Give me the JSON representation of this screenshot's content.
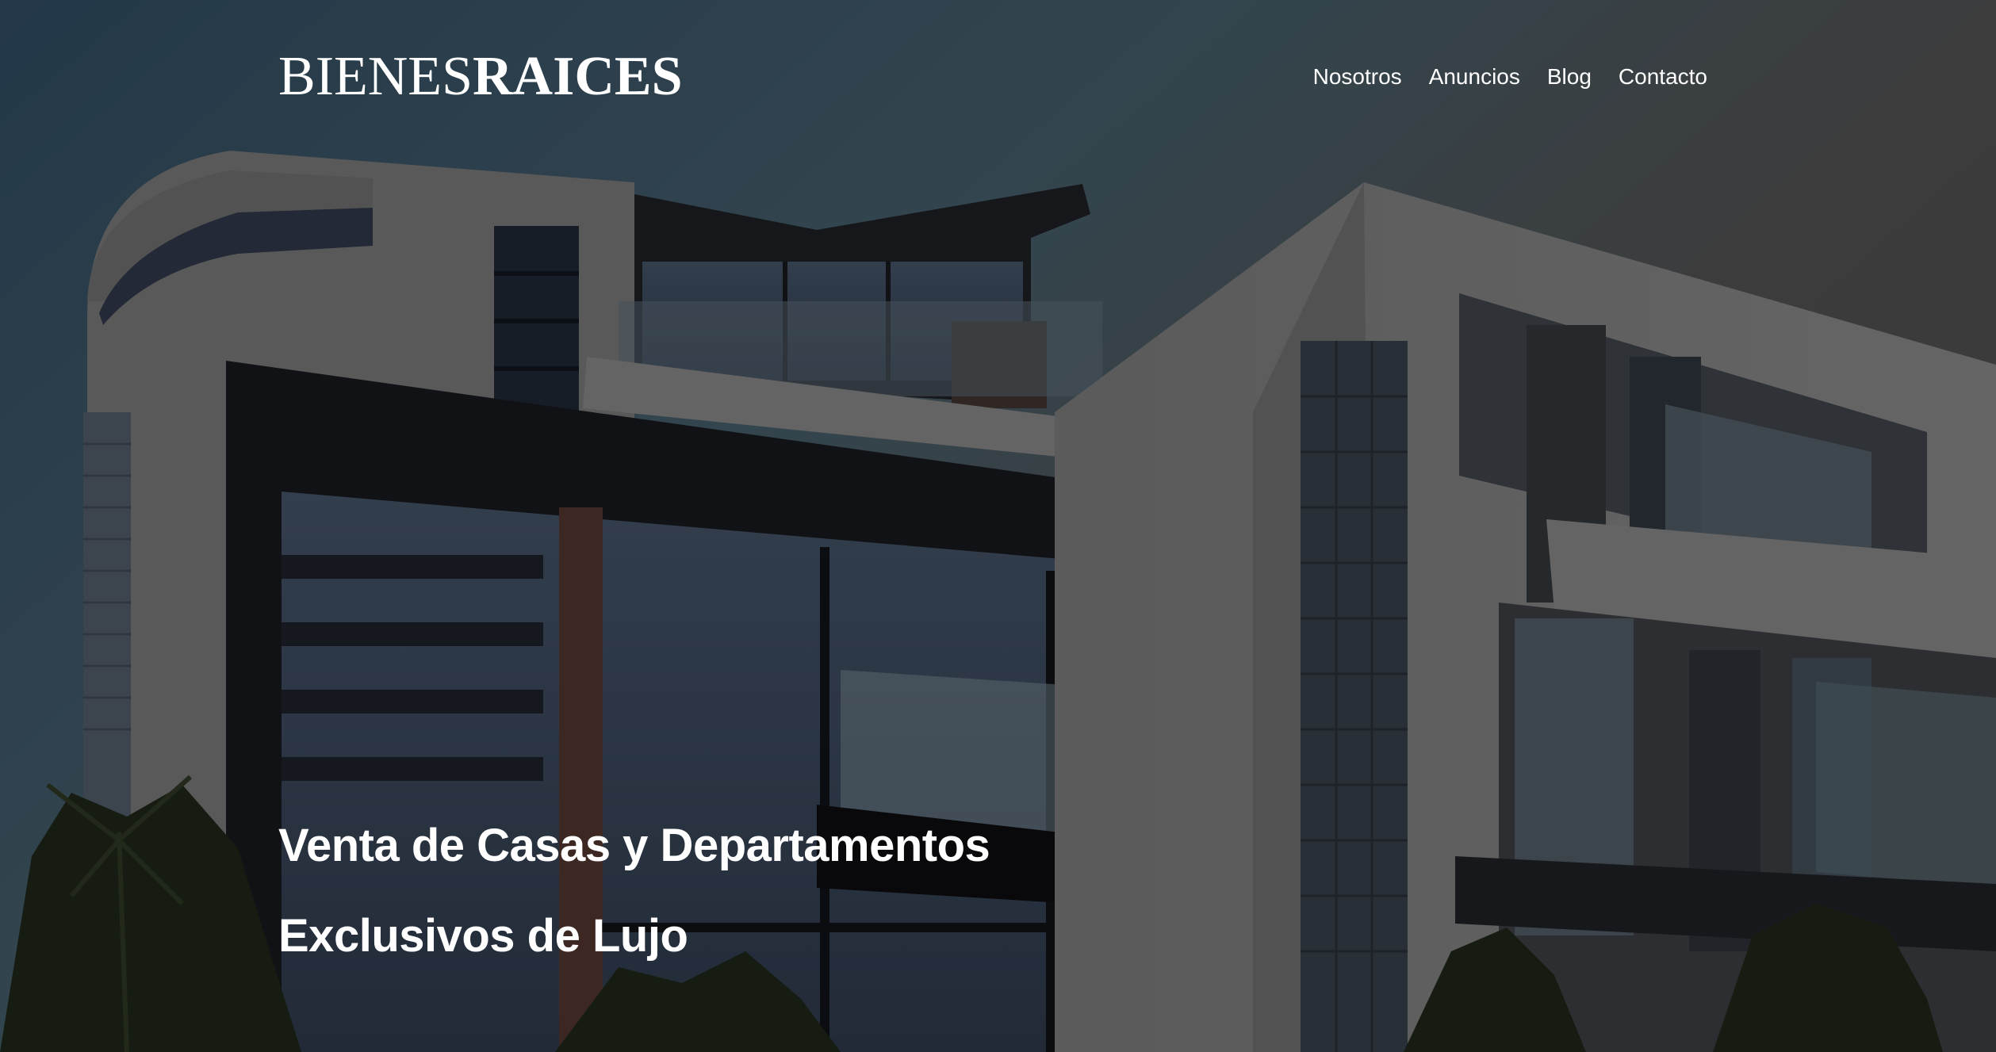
{
  "header": {
    "logo_regular": "BIENES",
    "logo_bold": "RAICES",
    "nav": [
      {
        "label": "Nosotros"
      },
      {
        "label": "Anuncios"
      },
      {
        "label": "Blog"
      },
      {
        "label": "Contacto"
      }
    ]
  },
  "hero": {
    "heading_line1": "Venta de Casas y Departamentos",
    "heading_line2": "Exclusivos de Lujo"
  },
  "colors": {
    "overlay": "#000000",
    "text": "#ffffff",
    "sky": "#2e4a5e"
  },
  "icons": []
}
